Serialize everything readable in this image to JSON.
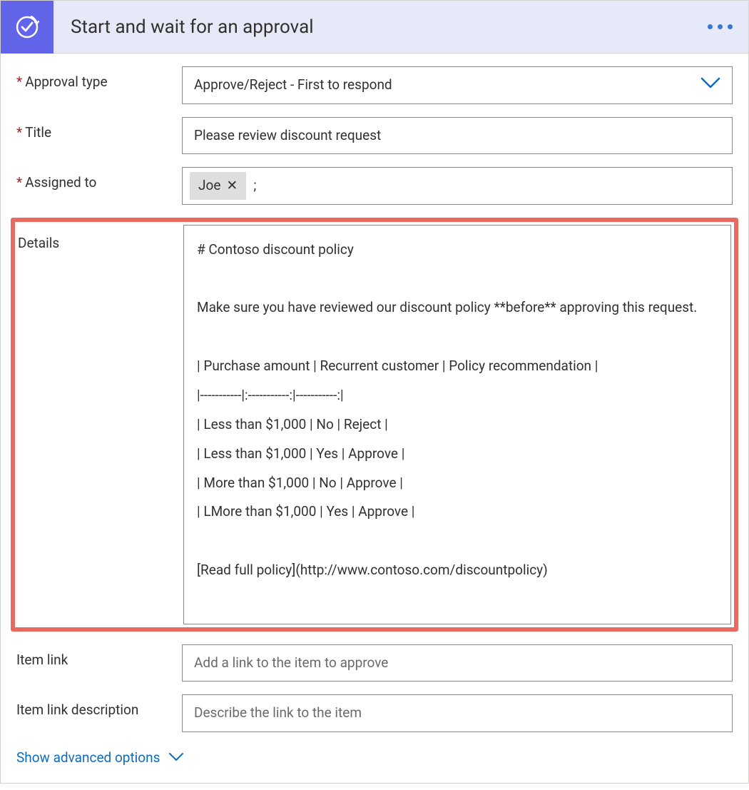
{
  "header": {
    "title": "Start and wait for an approval"
  },
  "fields": {
    "approval_type": {
      "label": "Approval type",
      "value": "Approve/Reject - First to respond"
    },
    "title": {
      "label": "Title",
      "value": "Please review discount request"
    },
    "assigned_to": {
      "label": "Assigned to",
      "token": "Joe",
      "separator": ";"
    },
    "details": {
      "label": "Details",
      "value": "# Contoso discount policy\n\nMake sure you have reviewed our discount policy **before** approving this request.\n\n| Purchase amount | Recurrent customer | Policy recommendation |\n|-----------|:-----------:|-----------:|\n| Less than $1,000 | No | Reject |\n| Less than $1,000 | Yes | Approve |\n| More than $1,000 | No | Approve |\n| LMore than $1,000 | Yes | Approve |\n\n[Read full policy](http://www.contoso.com/discountpolicy)"
    },
    "item_link": {
      "label": "Item link",
      "placeholder": "Add a link to the item to approve"
    },
    "item_link_desc": {
      "label": "Item link description",
      "placeholder": "Describe the link to the item"
    }
  },
  "footer": {
    "advanced": "Show advanced options"
  }
}
